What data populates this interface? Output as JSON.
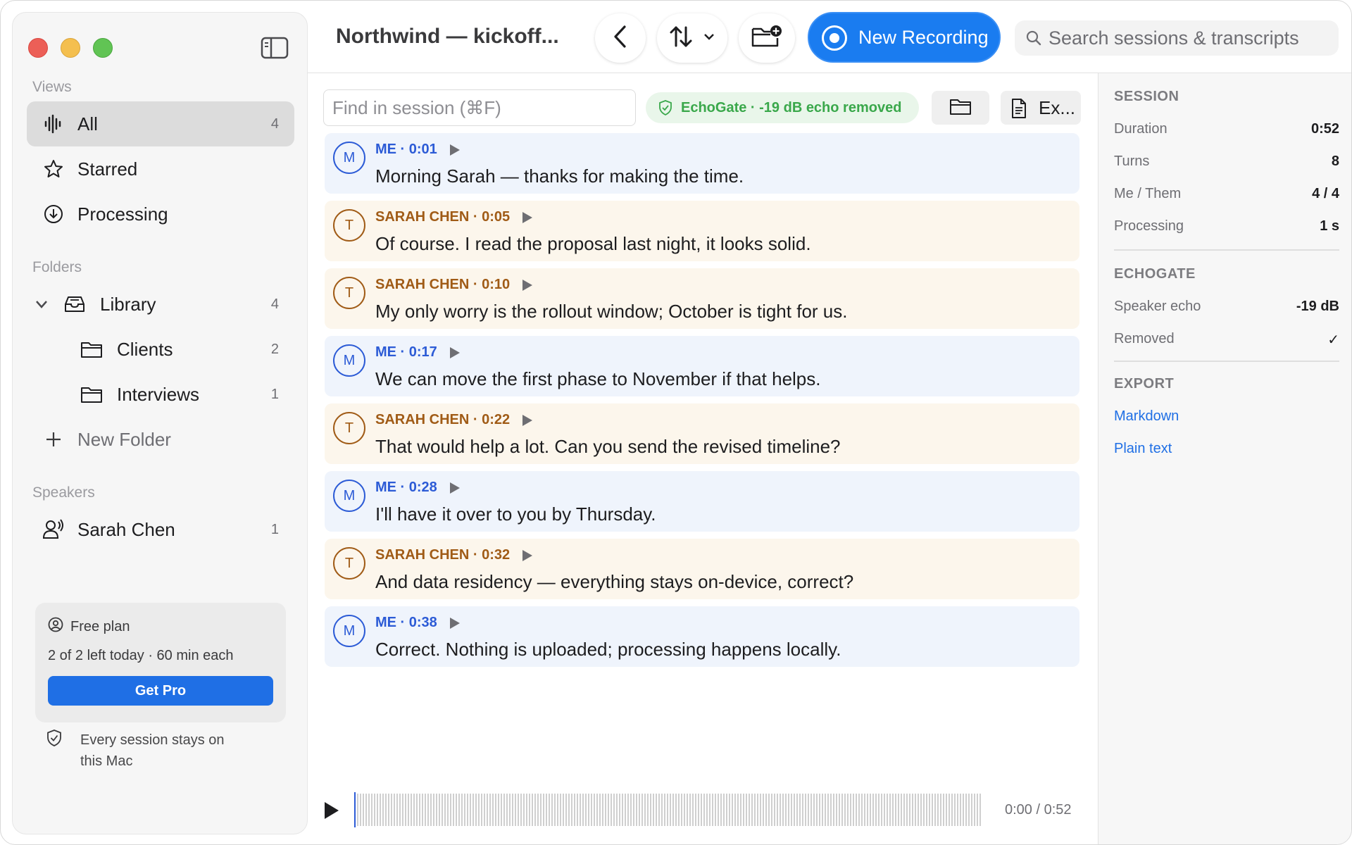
{
  "window": {
    "title": "Northwind — kickoff..."
  },
  "sidebar": {
    "views_label": "Views",
    "views": [
      {
        "label": "All",
        "count": "4",
        "icon": "waveform-icon"
      },
      {
        "label": "Starred",
        "count": "",
        "icon": "star-icon"
      },
      {
        "label": "Processing",
        "count": "",
        "icon": "download-circle-icon"
      }
    ],
    "folders_label": "Folders",
    "library": {
      "label": "Library",
      "count": "4"
    },
    "folders": [
      {
        "label": "Clients",
        "count": "2"
      },
      {
        "label": "Interviews",
        "count": "1"
      }
    ],
    "new_folder": "New Folder",
    "speakers_label": "Speakers",
    "speakers": [
      {
        "label": "Sarah Chen",
        "count": "1"
      }
    ],
    "plan": {
      "name": "Free plan",
      "usage": "2 of 2 left today · 60 min each",
      "cta": "Get Pro"
    },
    "privacy": "Every session stays on this Mac"
  },
  "toolbar": {
    "new_recording": "New Recording",
    "search_placeholder": "Search sessions & transcripts"
  },
  "main": {
    "find_placeholder": "Find in session (⌘F)",
    "echo_badge": "EchoGate · -19 dB echo removed",
    "export_label": "Ex...",
    "turns": [
      {
        "who": "me",
        "initial": "M",
        "header": "ME · 0:01",
        "text": "Morning Sarah — thanks for making the time."
      },
      {
        "who": "them",
        "initial": "T",
        "header": "SARAH CHEN · 0:05",
        "text": "Of course. I read the proposal last night, it looks solid."
      },
      {
        "who": "them",
        "initial": "T",
        "header": "SARAH CHEN · 0:10",
        "text": "My only worry is the rollout window; October is tight for us."
      },
      {
        "who": "me",
        "initial": "M",
        "header": "ME · 0:17",
        "text": "We can move the first phase to November if that helps."
      },
      {
        "who": "them",
        "initial": "T",
        "header": "SARAH CHEN · 0:22",
        "text": "That would help a lot. Can you send the revised timeline?"
      },
      {
        "who": "me",
        "initial": "M",
        "header": "ME · 0:28",
        "text": "I'll have it over to you by Thursday."
      },
      {
        "who": "them",
        "initial": "T",
        "header": "SARAH CHEN · 0:32",
        "text": "And data residency — everything stays on-device, correct?"
      },
      {
        "who": "me",
        "initial": "M",
        "header": "ME · 0:38",
        "text": "Correct. Nothing is uploaded; processing happens locally."
      }
    ],
    "player": {
      "time": "0:00 / 0:52",
      "progress": 0
    }
  },
  "inspector": {
    "session_label": "SESSION",
    "session": [
      {
        "label": "Duration",
        "value": "0:52"
      },
      {
        "label": "Turns",
        "value": "8"
      },
      {
        "label": "Me / Them",
        "value": "4 / 4"
      },
      {
        "label": "Processing",
        "value": "1 s"
      }
    ],
    "echogate_label": "ECHOGATE",
    "echogate": [
      {
        "label": "Speaker echo",
        "value": "-19 dB"
      },
      {
        "label": "Removed",
        "value": "✓"
      }
    ],
    "export_label": "EXPORT",
    "export": [
      "Markdown",
      "Plain text"
    ]
  },
  "colors": {
    "accent": "#1a7cf0",
    "me": "#2c5bd6",
    "them": "#a05b16",
    "echo": "#3aa84b"
  }
}
